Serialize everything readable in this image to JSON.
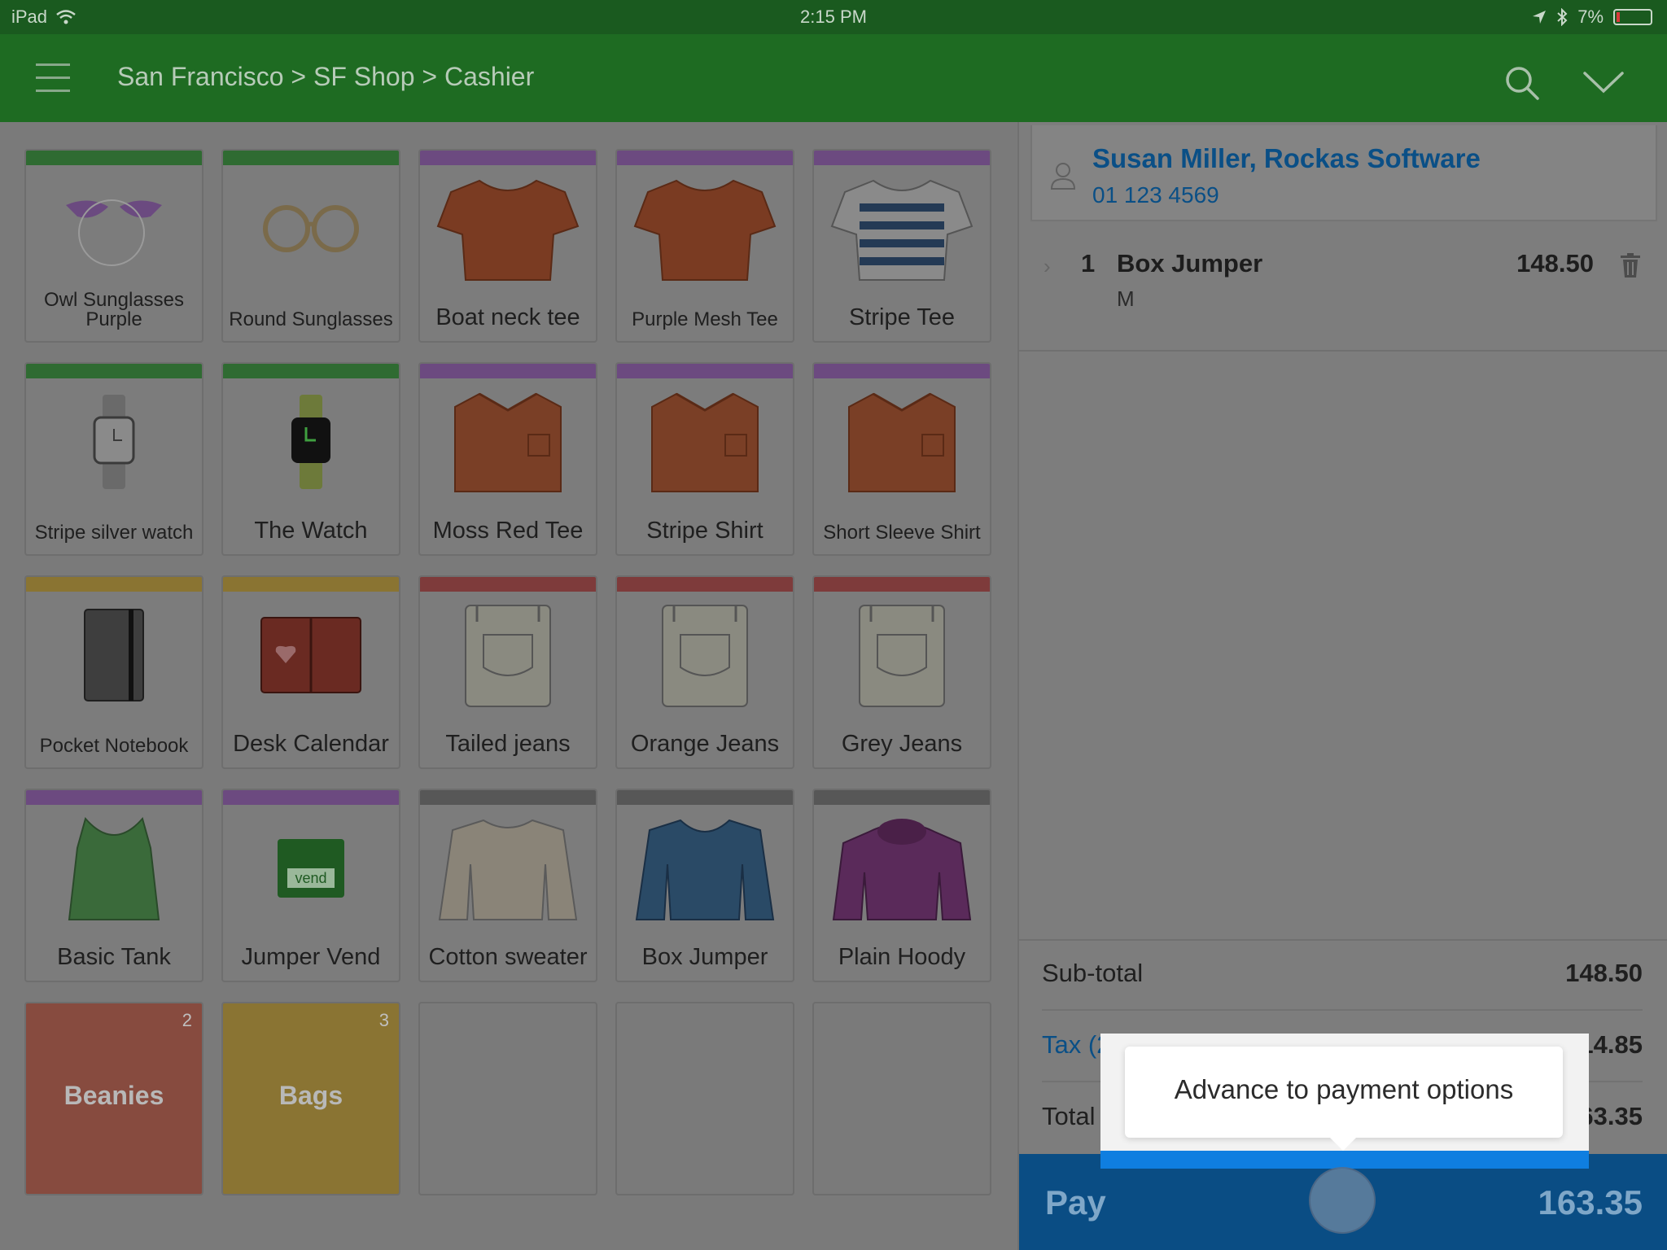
{
  "status_bar": {
    "device": "iPad",
    "time": "2:15 PM",
    "battery": "7%"
  },
  "header": {
    "breadcrumb": "San Francisco > SF Shop > Cashier"
  },
  "tiles": [
    {
      "label": "Owl Sunglasses Purple",
      "bar": "#2f6b32",
      "icon": "owl-sunglasses-icon"
    },
    {
      "label": "Round Sunglasses",
      "bar": "#2f6b32",
      "icon": "round-sunglasses-icon"
    },
    {
      "label": "Boat neck tee",
      "bar": "#6c4a80",
      "icon": "tshirt-icon"
    },
    {
      "label": "Purple Mesh Tee",
      "bar": "#6c4a80",
      "icon": "tshirt-icon"
    },
    {
      "label": "Stripe Tee",
      "bar": "#6c4a80",
      "icon": "stripe-tshirt-icon"
    },
    {
      "label": "Stripe silver watch",
      "bar": "#2f6b32",
      "icon": "watch-icon"
    },
    {
      "label": "The Watch",
      "bar": "#2f6b32",
      "icon": "smartwatch-icon"
    },
    {
      "label": "Moss Red Tee",
      "bar": "#6c4a80",
      "icon": "shirt-icon"
    },
    {
      "label": "Stripe Shirt",
      "bar": "#6c4a80",
      "icon": "shirt-icon"
    },
    {
      "label": "Short Sleeve Shirt",
      "bar": "#6c4a80",
      "icon": "shirt-icon"
    },
    {
      "label": "Pocket Notebook",
      "bar": "#8a7432",
      "icon": "notebook-icon"
    },
    {
      "label": "Desk Calendar",
      "bar": "#8a7432",
      "icon": "calendar-icon"
    },
    {
      "label": "Tailed jeans",
      "bar": "#7e3b3b",
      "icon": "jeans-icon"
    },
    {
      "label": "Orange Jeans",
      "bar": "#7e3b3b",
      "icon": "jeans-icon"
    },
    {
      "label": "Grey Jeans",
      "bar": "#7e3b3b",
      "icon": "jeans-icon"
    },
    {
      "label": "Basic Tank",
      "bar": "#6c4a80",
      "icon": "tank-top-icon"
    },
    {
      "label": "Jumper Vend",
      "bar": "#6c4a80",
      "icon": "vend-tee-icon"
    },
    {
      "label": "Cotton sweater",
      "bar": "#575757",
      "icon": "sweater-icon"
    },
    {
      "label": "Box Jumper",
      "bar": "#575757",
      "icon": "jumper-icon"
    },
    {
      "label": "Plain Hoody",
      "bar": "#575757",
      "icon": "hoodie-icon"
    }
  ],
  "folders": [
    {
      "label": "Beanies",
      "count": "2",
      "color": "#874b3f"
    },
    {
      "label": "Bags",
      "count": "3",
      "color": "#8a7433"
    }
  ],
  "customer": {
    "name": "Susan Miller, Rockas Software",
    "phone": "01 123 4569"
  },
  "sale": {
    "items": [
      {
        "qty": "1",
        "name": "Box Jumper",
        "variant": "M",
        "price": "148.50"
      }
    ],
    "subtotal_label": "Sub-total",
    "subtotal": "148.50",
    "tax_label": "Tax (2 taxes)",
    "tax": "14.85",
    "total_label": "Total",
    "total": "163.35",
    "pay_label": "Pay",
    "pay_amount": "163.35"
  },
  "tooltip": {
    "text": "Advance to payment options"
  },
  "colors": {
    "header": "#1e6b22",
    "pay": "#0a4d84",
    "link": "#0a4f86",
    "highlight": "#0f7ee0"
  }
}
